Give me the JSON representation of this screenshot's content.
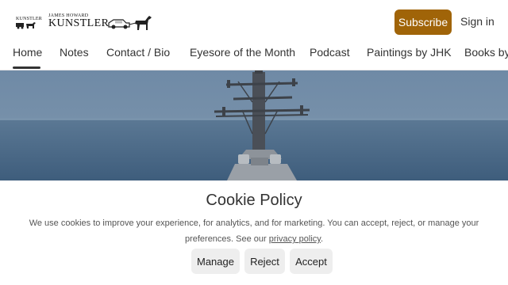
{
  "header": {
    "logo_small_text": "KUNSTLER",
    "logo_overline": "JAMES HOWARD",
    "logo_title": "KUNSTLER",
    "subscribe_label": "Subscribe",
    "signin_label": "Sign in",
    "accent_color": "#a06408"
  },
  "nav": {
    "items": [
      "Home",
      "Notes",
      "Contact / Bio",
      "Eyesore of the Month",
      "Podcast",
      "Paintings by JHK",
      "Books by"
    ],
    "active": "Home"
  },
  "hero": {
    "image_icon": "warship-photo-icon"
  },
  "cookie": {
    "title": "Cookie Policy",
    "text_before_link": "We use cookies to improve your experience, for analytics, and for marketing. You can accept, reject, or manage your preferences. See our ",
    "link_text": "privacy policy",
    "text_after_link": ".",
    "buttons": {
      "manage": "Manage",
      "reject": "Reject",
      "accept": "Accept"
    }
  }
}
